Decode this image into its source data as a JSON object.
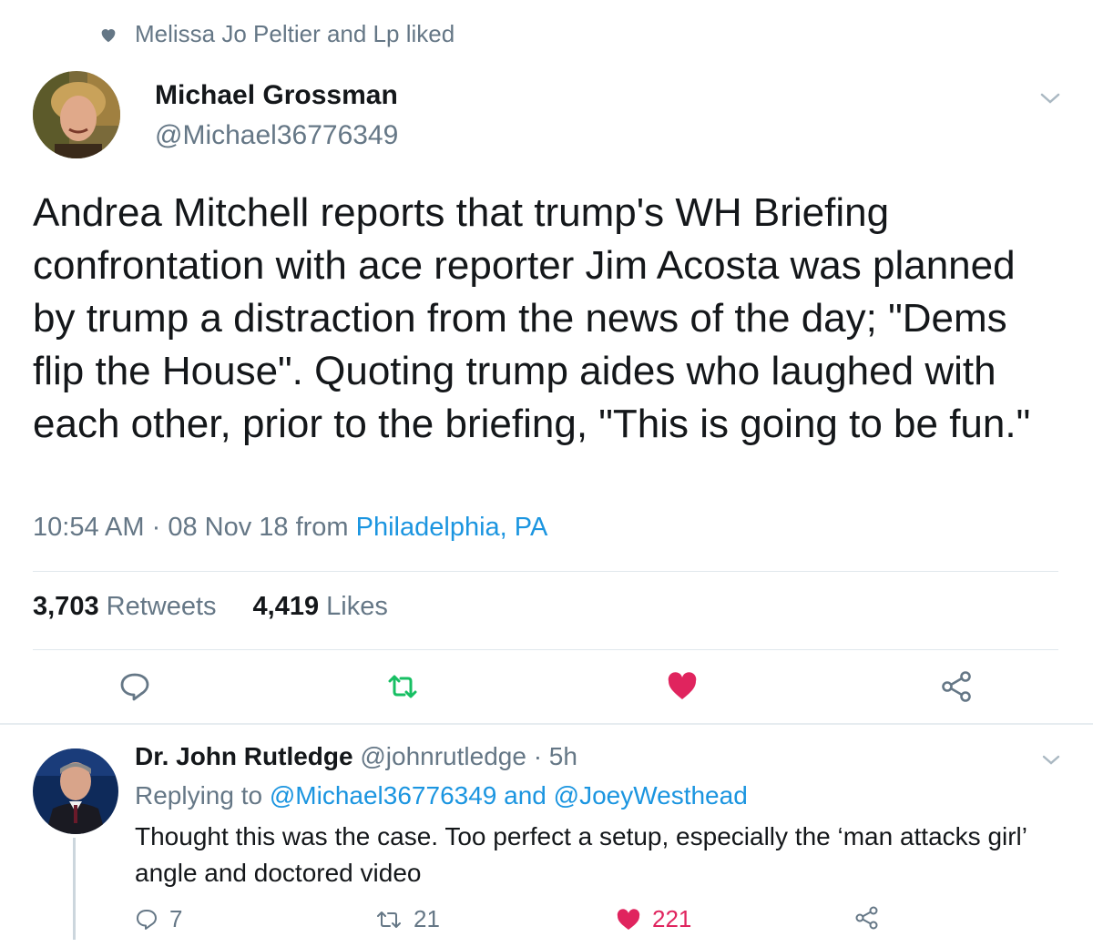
{
  "social_context": {
    "text": "Melissa Jo Peltier and Lp liked"
  },
  "tweet": {
    "author_name": "Michael Grossman",
    "author_handle": "@Michael36776349",
    "text": "Andrea Mitchell reports that trump's WH Briefing confrontation with ace reporter Jim Acosta was planned by trump a distraction from the news of the day; \"Dems flip the House\". Quoting trump aides who laughed with each other, prior to the briefing, \"This is going to be fun.\"",
    "time": "10:54 AM",
    "date": "08 Nov 18",
    "from_label": "from",
    "location": "Philadelphia, PA",
    "retweets_count": "3,703",
    "retweets_label": "Retweets",
    "likes_count": "4,419",
    "likes_label": "Likes",
    "icons": [
      "reply-icon",
      "retweet-icon",
      "like-icon",
      "share-icon"
    ],
    "colors": {
      "retweet": "#17bf63",
      "like": "#e0245e",
      "link": "#1b95e0"
    }
  },
  "reply": {
    "author_name": "Dr. John Rutledge",
    "author_handle": "@johnrutledge",
    "age": "5h",
    "replying_prefix": "Replying to",
    "replying_user1": "@Michael36776349",
    "replying_and": "and",
    "replying_user2": "@JoeyWesthead",
    "text": "Thought this was the case. Too perfect a setup, especially the ‘man attacks girl’ angle and doctored video",
    "reply_count": "7",
    "retweet_count": "21",
    "like_count": "221"
  }
}
